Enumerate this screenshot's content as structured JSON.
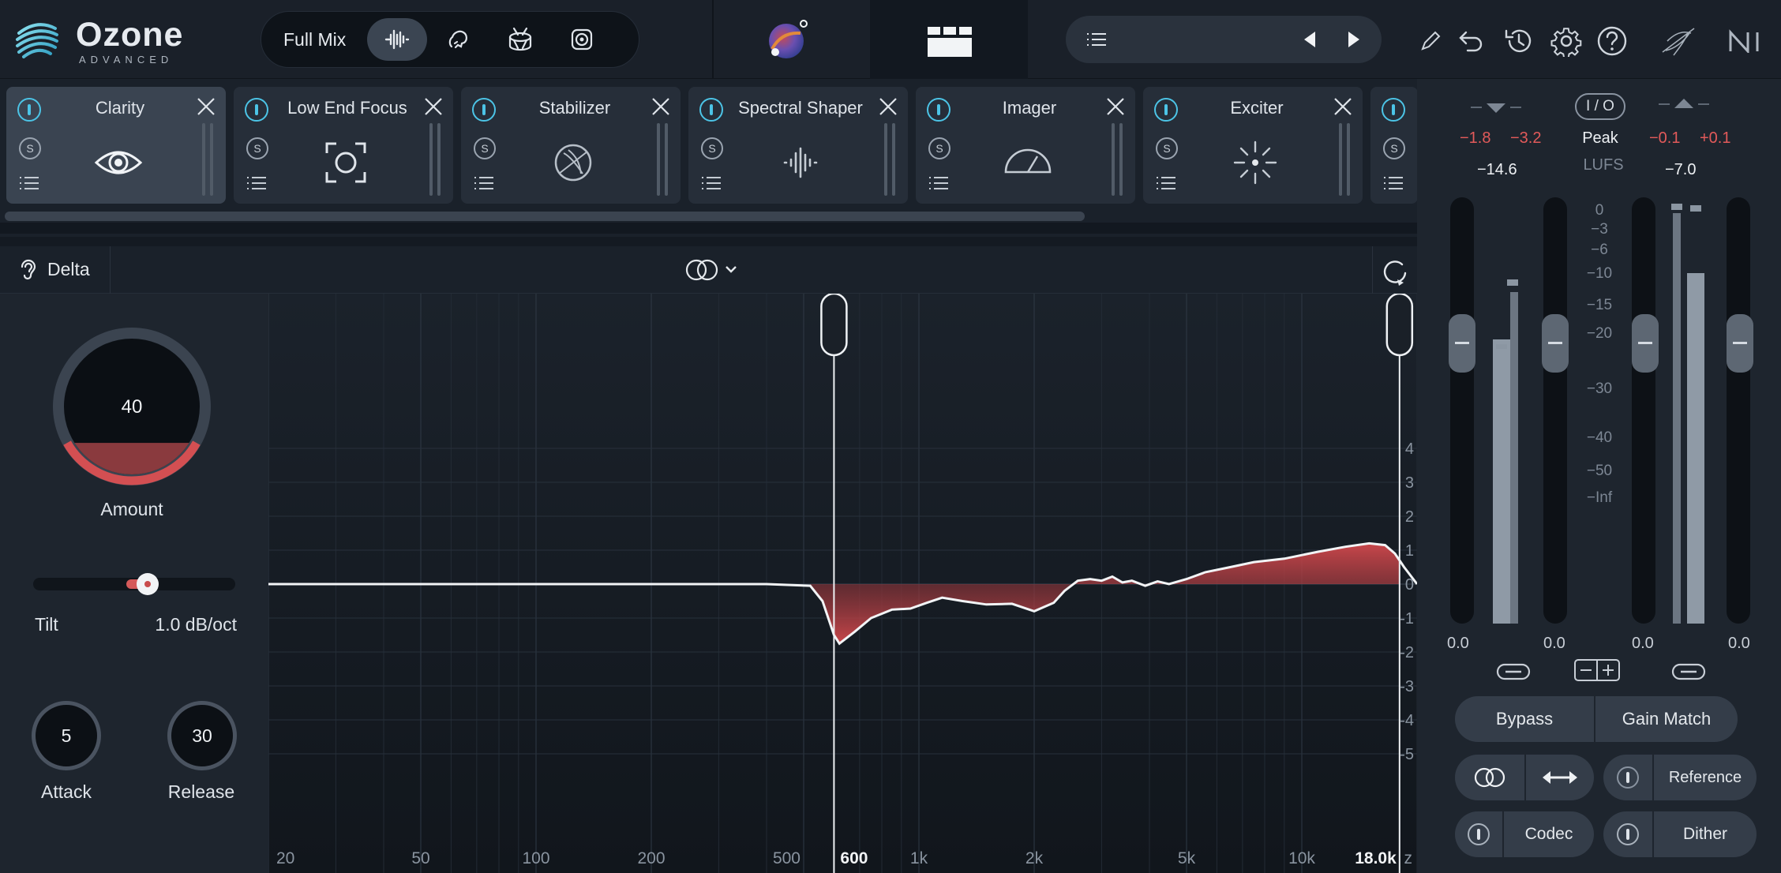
{
  "app": {
    "name": "Ozone",
    "edition": "ADVANCED"
  },
  "toolbar": {
    "mix_label": "Full Mix",
    "mix_modes": [
      "full-mix-icon",
      "vocal-icon",
      "drum-icon",
      "bass-speaker-icon"
    ],
    "active_mode": 0
  },
  "modules": [
    {
      "name": "Clarity",
      "icon": "eye-icon",
      "selected": true
    },
    {
      "name": "Low End Focus",
      "icon": "focus-icon",
      "selected": false
    },
    {
      "name": "Stabilizer",
      "icon": "stabilizer-icon",
      "selected": false
    },
    {
      "name": "Spectral Shaper",
      "icon": "spectral-icon",
      "selected": false
    },
    {
      "name": "Imager",
      "icon": "imager-icon",
      "selected": false
    },
    {
      "name": "Exciter",
      "icon": "exciter-icon",
      "selected": false
    }
  ],
  "control_strip": {
    "delta_label": "Delta"
  },
  "controls": {
    "amount": {
      "value": "40",
      "label": "Amount",
      "fraction": 0.4
    },
    "tilt": {
      "label": "Tilt",
      "value": "1.0 dB/oct",
      "position": 0.4
    },
    "attack": {
      "value": "5",
      "label": "Attack"
    },
    "release": {
      "value": "30",
      "label": "Release"
    }
  },
  "graph": {
    "freq_ticks": [
      {
        "label": "20",
        "hz": 20
      },
      {
        "label": "50",
        "hz": 50
      },
      {
        "label": "100",
        "hz": 100
      },
      {
        "label": "200",
        "hz": 200
      },
      {
        "label": "500",
        "hz": 500
      },
      {
        "label": "1k",
        "hz": 1000
      },
      {
        "label": "2k",
        "hz": 2000
      },
      {
        "label": "5k",
        "hz": 5000
      },
      {
        "label": "10k",
        "hz": 10000
      }
    ],
    "unit_label": "z",
    "db_ticks": [
      "4",
      "3",
      "2",
      "1",
      "0",
      "-1",
      "-2",
      "-3",
      "-4",
      "-5"
    ],
    "handles": [
      {
        "label": "600",
        "hz": 600
      },
      {
        "label": "18.0k",
        "hz": 18000
      }
    ],
    "curve": [
      [
        20,
        0
      ],
      [
        400,
        0
      ],
      [
        520,
        -0.05
      ],
      [
        560,
        -0.5
      ],
      [
        600,
        -1.5
      ],
      [
        620,
        -1.75
      ],
      [
        680,
        -1.4
      ],
      [
        750,
        -1.0
      ],
      [
        850,
        -0.75
      ],
      [
        950,
        -0.72
      ],
      [
        1050,
        -0.55
      ],
      [
        1150,
        -0.4
      ],
      [
        1300,
        -0.5
      ],
      [
        1500,
        -0.6
      ],
      [
        1750,
        -0.58
      ],
      [
        2000,
        -0.8
      ],
      [
        2250,
        -0.55
      ],
      [
        2400,
        -0.2
      ],
      [
        2600,
        0.1
      ],
      [
        2800,
        0.15
      ],
      [
        3000,
        0.1
      ],
      [
        3200,
        0.22
      ],
      [
        3400,
        0.05
      ],
      [
        3600,
        0.1
      ],
      [
        3900,
        -0.05
      ],
      [
        4200,
        0.08
      ],
      [
        4500,
        0.0
      ],
      [
        5000,
        0.15
      ],
      [
        5600,
        0.35
      ],
      [
        6500,
        0.5
      ],
      [
        7500,
        0.65
      ],
      [
        9000,
        0.75
      ],
      [
        11000,
        0.95
      ],
      [
        13000,
        1.1
      ],
      [
        15000,
        1.2
      ],
      [
        16500,
        1.15
      ],
      [
        17500,
        0.9
      ],
      [
        18500,
        0.5
      ],
      [
        20000,
        0.0
      ]
    ]
  },
  "meters": {
    "in_peaks": [
      "−1.8",
      "−3.2"
    ],
    "out_peaks": [
      "−0.1",
      "+0.1"
    ],
    "io_label": "I / O",
    "mode_label": "Peak",
    "unit_label": "LUFS",
    "in_lufs": "−14.6",
    "out_lufs": "−7.0",
    "scale": [
      "0",
      "−3",
      "−6",
      "−10",
      "−15",
      "−20",
      "−30",
      "−40",
      "−50",
      "−Inf"
    ],
    "gains": [
      "0.0",
      "0.0",
      "0.0",
      "0.0"
    ]
  },
  "buttons": {
    "bypass": "Bypass",
    "gain_match": "Gain Match",
    "reference": "Reference",
    "codec": "Codec",
    "dither": "Dither"
  }
}
